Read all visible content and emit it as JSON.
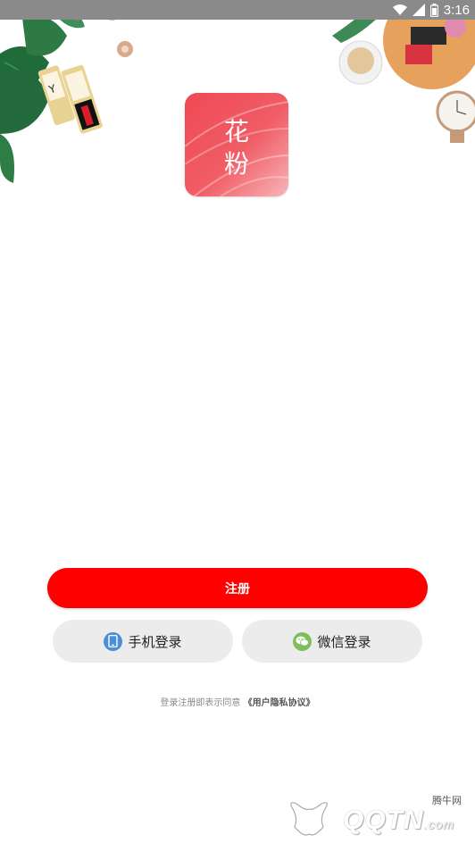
{
  "status_bar": {
    "time": "3:16",
    "icons": [
      "wifi-icon",
      "signal-icon",
      "battery-icon"
    ]
  },
  "app": {
    "logo_chars": [
      "花",
      "粉"
    ]
  },
  "actions": {
    "register_label": "注册",
    "phone_login_label": "手机登录",
    "wechat_login_label": "微信登录"
  },
  "agreement": {
    "prefix": "登录注册即表示同意",
    "link": "《用户隐私协议》"
  },
  "watermark": {
    "site": "腾牛网",
    "logo": "QQTN",
    "suffix": ".com"
  },
  "colors": {
    "register_button": "#fe0000",
    "logo_bg": "#ee4a55",
    "login_button_bg": "#ececec",
    "phone_icon": "#4a90d9",
    "wechat_icon": "#7fbe5c"
  }
}
